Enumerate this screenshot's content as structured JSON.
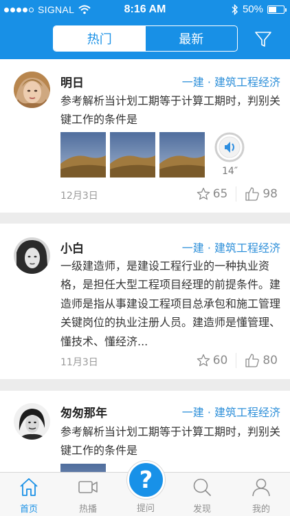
{
  "status_bar": {
    "carrier": "SIGNAL",
    "time": "8:16 AM",
    "battery": "50%",
    "battery_level": 0.5
  },
  "nav": {
    "tabs": [
      {
        "label": "热门",
        "active": true
      },
      {
        "label": "最新",
        "active": false
      }
    ],
    "filter_icon": "filter-icon"
  },
  "posts": [
    {
      "author": "明日",
      "category": "一建 · 建筑工程经济",
      "content": "参考解析当计划工期等于计算工期时，判别关键工作的条件是",
      "images": 3,
      "audio_duration": "14″",
      "date": "12月3日",
      "stars": "65",
      "likes": "98"
    },
    {
      "author": "小白",
      "category": "一建 · 建筑工程经济",
      "content": "一级建造师，是建设工程行业的一种执业资格，是担任大型工程项目经理的前提条件。建造师是指从事建设工程项目总承包和施工管理关键岗位的执业注册人员。建造师是懂管理、懂技术、懂经济...",
      "date": "11月3日",
      "stars": "60",
      "likes": "80"
    },
    {
      "author": "匆匆那年",
      "category": "一建 · 建筑工程经济",
      "content": "参考解析当计划工期等于计算工期时，判别关键工作的条件是"
    }
  ],
  "tabbar": {
    "items": [
      {
        "label": "首页",
        "icon": "home-icon",
        "active": true
      },
      {
        "label": "热播",
        "icon": "video-camera-icon",
        "active": false
      },
      {
        "label": "提问",
        "icon": "question-icon",
        "active": false
      },
      {
        "label": "发现",
        "icon": "search-icon",
        "active": false
      },
      {
        "label": "我的",
        "icon": "user-icon",
        "active": false
      }
    ]
  },
  "colors": {
    "brand": "#1890e6",
    "category": "#2d8fd9"
  }
}
